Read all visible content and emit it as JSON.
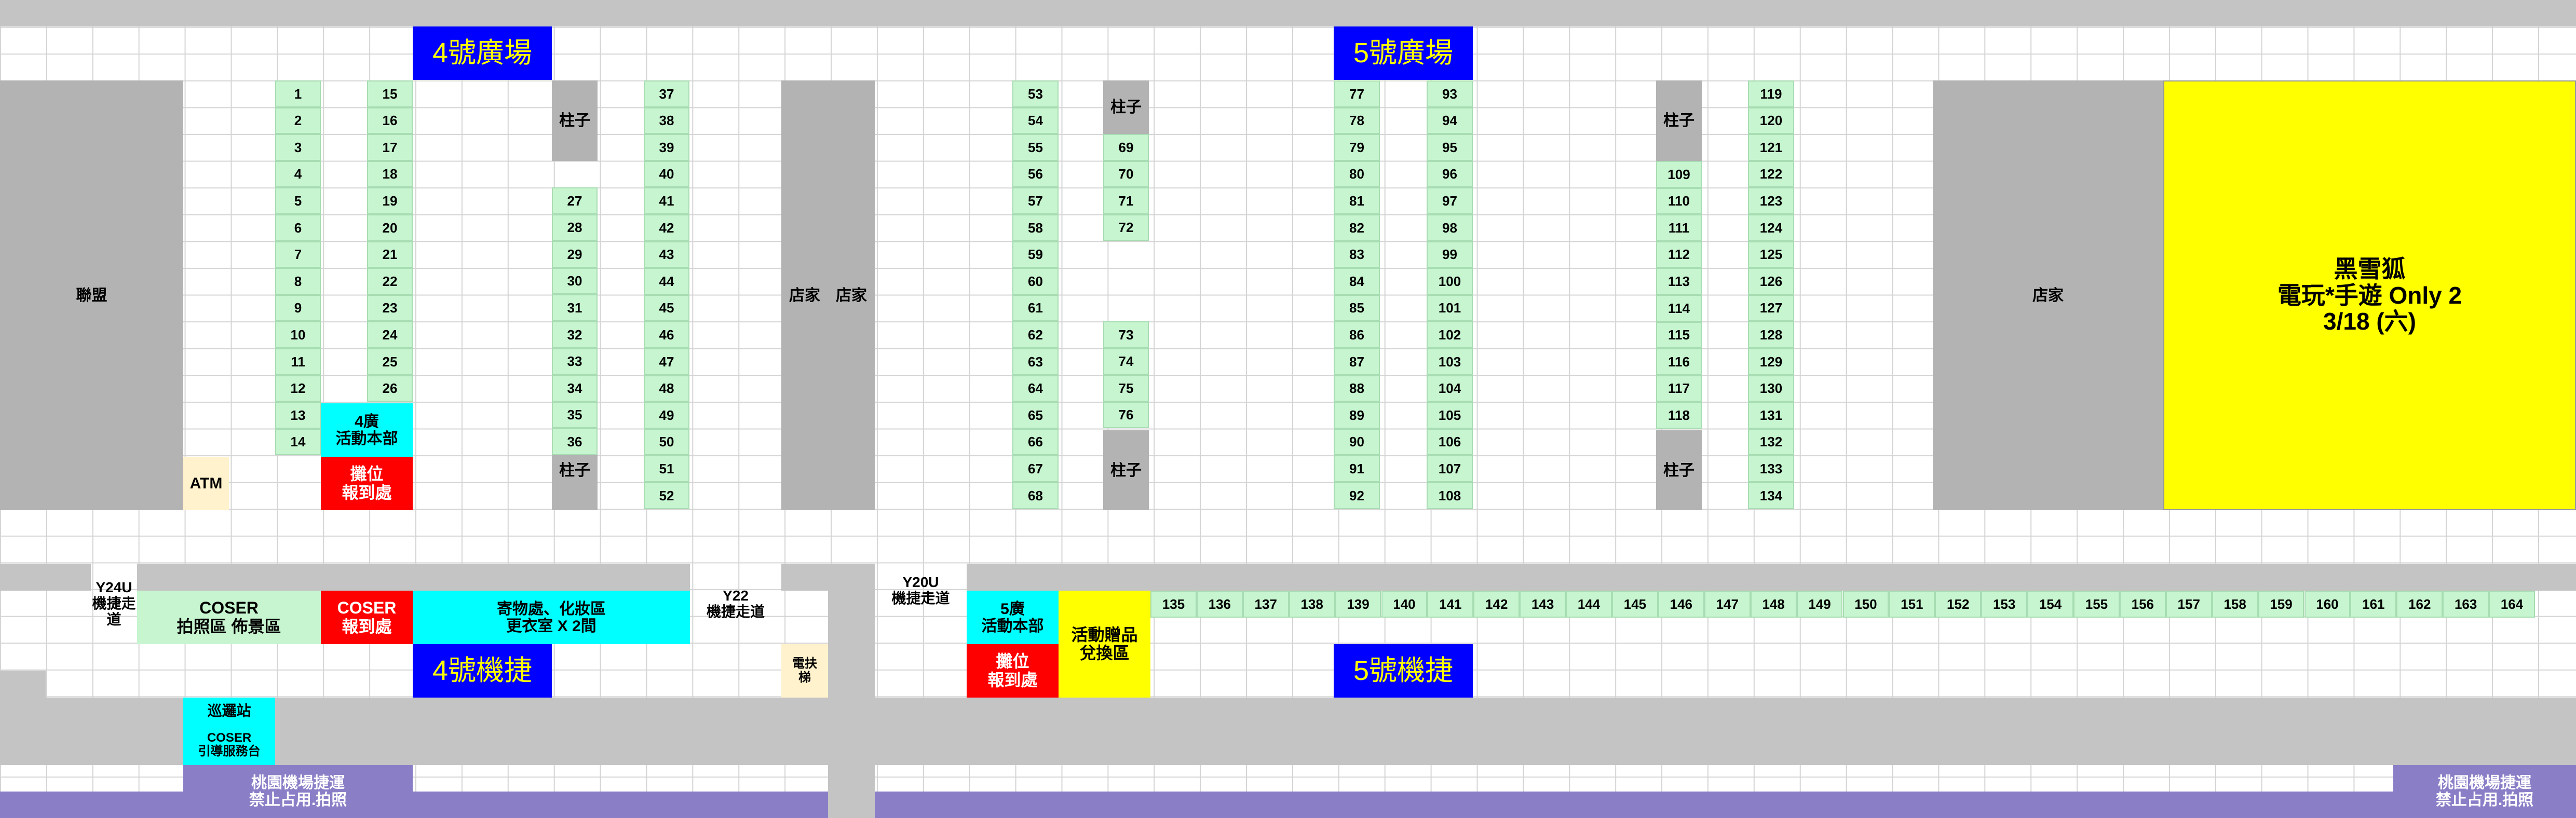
{
  "squares": {
    "sq4": "4號廣場",
    "sq5": "5號廣場"
  },
  "mrt": {
    "mrt4": "4號機捷",
    "mrt5": "5號機捷"
  },
  "areas": {
    "info_board": "聯盟",
    "shop": "店家",
    "pillar": "柱子",
    "atm": "ATM",
    "hq_4": "4廣\n活動本部",
    "hq_5": "5廣\n活動本部",
    "booth_checkin": "攤位\n報到處",
    "black_snow_fox": "黑雪狐\n電玩*手遊 Only 2\n3/18 (六)",
    "y24u": "Y24U\n機捷走道",
    "y22": "Y22\n機捷走道",
    "y20u": "Y20U\n機捷走道",
    "coser_photo": "COSER\n拍照區 佈景區",
    "coser_checkin": "COSER\n報到處",
    "locker": "寄物處、化妝區\n更衣室 X 2間",
    "escalator": "電扶\n梯",
    "gift": "活動贈品\n兌換區",
    "patrol": "巡邏站",
    "coser_guide": "COSER\n引導服務台",
    "corridor": "桃園機場捷運\n禁止占用.拍照"
  },
  "booths": {
    "c1": [
      "1",
      "2",
      "3",
      "4",
      "5",
      "6",
      "7",
      "8",
      "9",
      "10",
      "11",
      "12",
      "13",
      "14"
    ],
    "c2": [
      "15",
      "16",
      "17",
      "18",
      "19",
      "20",
      "21",
      "22",
      "23",
      "24",
      "25",
      "26"
    ],
    "c3": [
      "27",
      "28",
      "29",
      "30",
      "31",
      "32",
      "33",
      "34",
      "35",
      "36"
    ],
    "c4": [
      "37",
      "38",
      "39",
      "40",
      "41",
      "42",
      "43",
      "44",
      "45",
      "46",
      "47",
      "48",
      "49",
      "50",
      "51",
      "52"
    ],
    "c5": [
      "53",
      "54",
      "55",
      "56",
      "57",
      "58",
      "59",
      "60",
      "61",
      "62",
      "63",
      "64",
      "65",
      "66",
      "67",
      "68"
    ],
    "c6a": [
      "69",
      "70",
      "71",
      "72"
    ],
    "c6b": [
      "73",
      "74",
      "75",
      "76"
    ],
    "c7": [
      "77",
      "78",
      "79",
      "80",
      "81",
      "82",
      "83",
      "84",
      "85",
      "86",
      "87",
      "88",
      "89",
      "90",
      "91",
      "92"
    ],
    "c8": [
      "93",
      "94",
      "95",
      "96",
      "97",
      "98",
      "99",
      "100",
      "101",
      "102",
      "103",
      "104",
      "105",
      "106",
      "107",
      "108"
    ],
    "c9": [
      "109",
      "110",
      "111",
      "112",
      "113",
      "114",
      "115",
      "116",
      "117",
      "118"
    ],
    "c10": [
      "119",
      "120",
      "121",
      "122",
      "123",
      "124",
      "125",
      "126",
      "127",
      "128",
      "129",
      "130",
      "131",
      "132",
      "133",
      "134"
    ],
    "row": [
      "135",
      "136",
      "137",
      "138",
      "139",
      "140",
      "141",
      "142",
      "143",
      "144",
      "145",
      "146",
      "147",
      "148",
      "149",
      "150",
      "151",
      "152",
      "153",
      "154",
      "155",
      "156",
      "157",
      "158",
      "159",
      "160",
      "161",
      "162",
      "163",
      "164"
    ]
  }
}
